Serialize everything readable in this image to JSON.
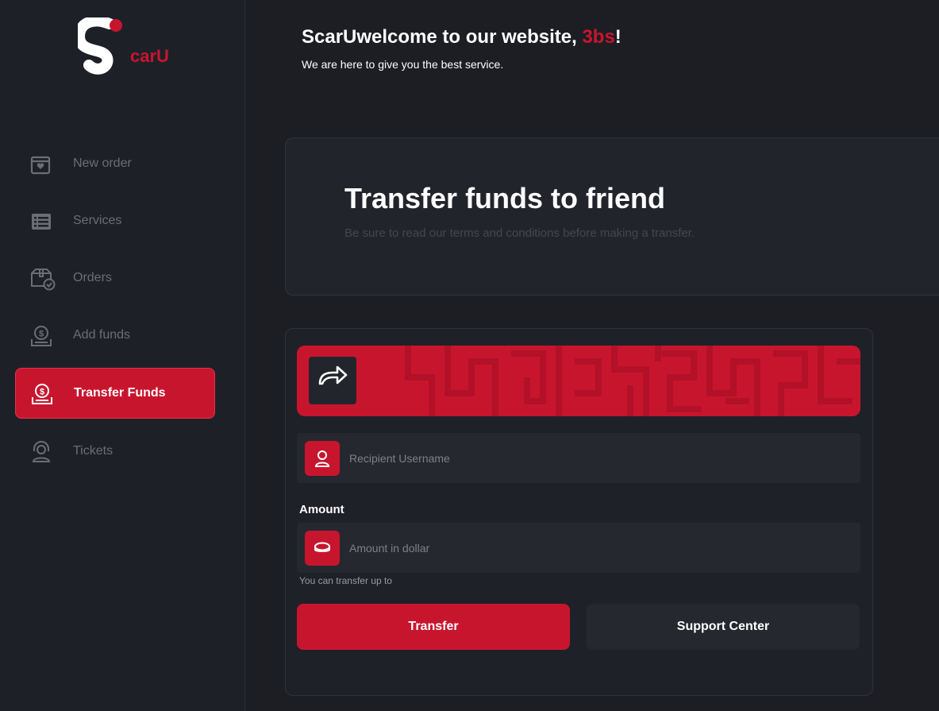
{
  "brand": {
    "logo_text": "carU",
    "accent_color": "#c8152e"
  },
  "sidebar": {
    "items": [
      {
        "label": "New order",
        "icon": "heart-box-icon",
        "active": false
      },
      {
        "label": "Services",
        "icon": "list-icon",
        "active": false
      },
      {
        "label": "Orders",
        "icon": "box-check-icon",
        "active": false
      },
      {
        "label": "Add funds",
        "icon": "dollar-coin-icon",
        "active": false
      },
      {
        "label": "Transfer Funds",
        "icon": "dollar-transfer-icon",
        "active": true
      },
      {
        "label": "Tickets",
        "icon": "support-agent-icon",
        "active": false
      }
    ]
  },
  "header": {
    "title_prefix": "ScarUwelcome to our website, ",
    "username": "3bs",
    "title_suffix": "!",
    "subtitle": "We are here to give you the best service."
  },
  "banner": {
    "title": "Transfer funds to friend",
    "subtitle": "Be sure to read our terms and conditions before making a transfer."
  },
  "form": {
    "share_icon": "share-arrow-icon",
    "recipient_placeholder": "Recipient Username",
    "recipient_icon": "user-icon",
    "amount_label": "Amount",
    "amount_placeholder": "Amount in dollar",
    "amount_icon": "coin-icon",
    "hint": "You can transfer up to",
    "transfer_button": "Transfer",
    "support_button": "Support Center"
  }
}
